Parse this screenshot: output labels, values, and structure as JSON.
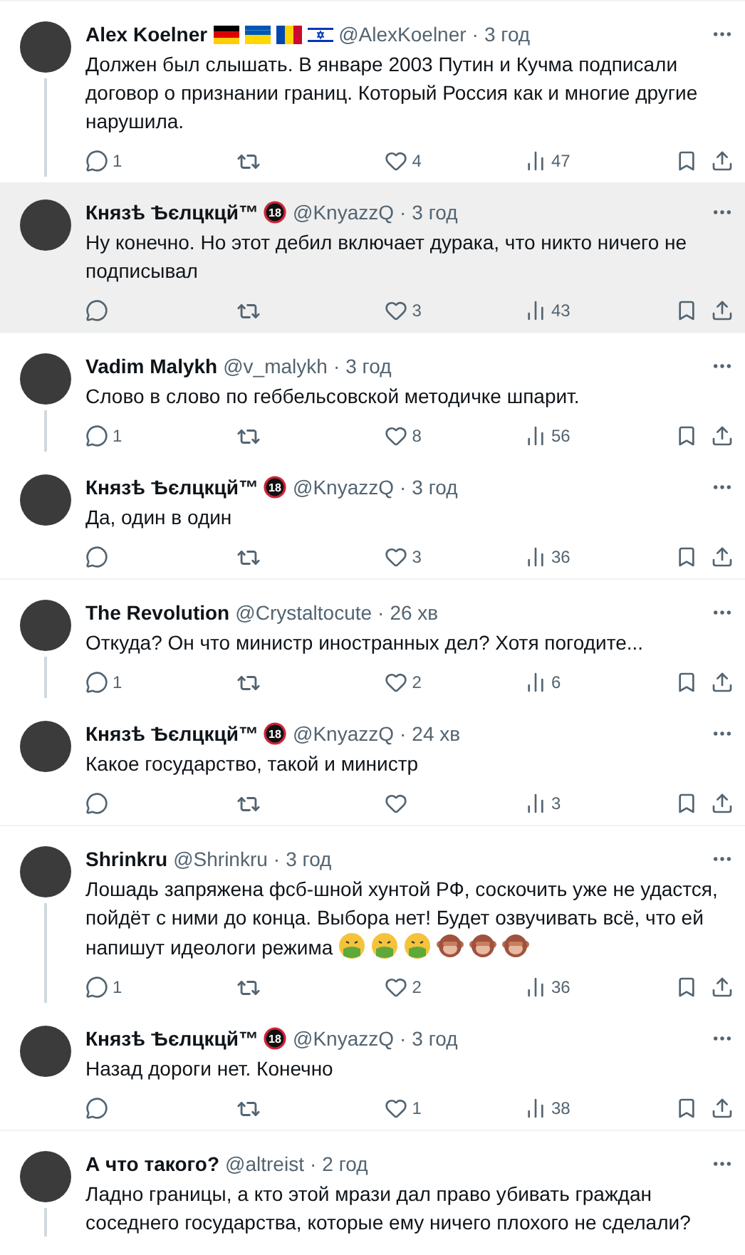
{
  "threads": [
    {
      "tweets": [
        {
          "name": "Alex Koelner",
          "flags": [
            {
              "kind": "de"
            },
            {
              "kind": "ua"
            },
            {
              "kind": "md"
            },
            {
              "kind": "il"
            }
          ],
          "handle": "@AlexKoelner",
          "dot": "·",
          "time": "3 год",
          "text": "Должен был слышать. В январе 2003 Путин и Кучма подписали договор о признании границ. Который Россия как и многие другие нарушила.",
          "replies": "1",
          "likes": "4",
          "views": "47",
          "highlighted": false
        },
        {
          "name": "Князѣ Ѣєлцкцй™",
          "badge": "18",
          "handle": "@KnyazzQ",
          "dot": "·",
          "time": "3 год",
          "text": "Ну конечно. Но этот дебил включает дурака, что никто ничего не подписывал",
          "likes": "3",
          "views": "43",
          "highlighted": true
        }
      ]
    },
    {
      "tweets": [
        {
          "name": "Vadim Malykh",
          "handle": "@v_malykh",
          "dot": "·",
          "time": "3 год",
          "text": "Слово в слово по геббельсовской  методичке шпарит.",
          "replies": "1",
          "likes": "8",
          "views": "56",
          "highlighted": false
        },
        {
          "name": "Князѣ Ѣєлцкцй™",
          "badge": "18",
          "handle": "@KnyazzQ",
          "dot": "·",
          "time": "3 год",
          "text": "Да, один в один",
          "likes": "3",
          "views": "36",
          "highlighted": false
        }
      ]
    },
    {
      "tweets": [
        {
          "name": "The Revolution",
          "handle": "@Crystaltocute",
          "dot": "·",
          "time": "26 хв",
          "text": "Откуда? Он что министр иностранных дел? Хотя погодите...",
          "replies": "1",
          "likes": "2",
          "views": "6",
          "highlighted": false
        },
        {
          "name": "Князѣ Ѣєлцкцй™",
          "badge": "18",
          "handle": "@KnyazzQ",
          "dot": "·",
          "time": "24 хв",
          "text": "Какое государство, такой и министр",
          "views": "3",
          "highlighted": false
        }
      ]
    },
    {
      "tweets": [
        {
          "name": "Shrinkru",
          "handle": "@Shrinkru",
          "dot": "·",
          "time": "3 год",
          "text": "Лошадь запряжена фсб-шной хунтой РФ, соскочить уже не удастся, пойдёт с ними до конца. Выбора нет! Будет озвучивать всё, что ей напишут идеологи режима",
          "emojis": [
            {
              "kind": "nauseated"
            },
            {
              "kind": "nauseated"
            },
            {
              "kind": "nauseated"
            },
            {
              "kind": "monkey"
            },
            {
              "kind": "monkey"
            },
            {
              "kind": "monkey"
            }
          ],
          "replies": "1",
          "likes": "2",
          "views": "36",
          "highlighted": false
        },
        {
          "name": "Князѣ Ѣєлцкцй™",
          "badge": "18",
          "handle": "@KnyazzQ",
          "dot": "·",
          "time": "3 год",
          "text": "Назад дороги нет. Конечно",
          "likes": "1",
          "views": "38",
          "highlighted": false
        }
      ]
    },
    {
      "tweets": [
        {
          "name": "А что такого?",
          "handle": "@altreist",
          "dot": "·",
          "time": "2 год",
          "text": "Ладно границы, а кто этой мрази дал право убивать граждан соседнего государства, которые ему ничего плохого не сделали?",
          "highlighted": false
        }
      ]
    }
  ]
}
